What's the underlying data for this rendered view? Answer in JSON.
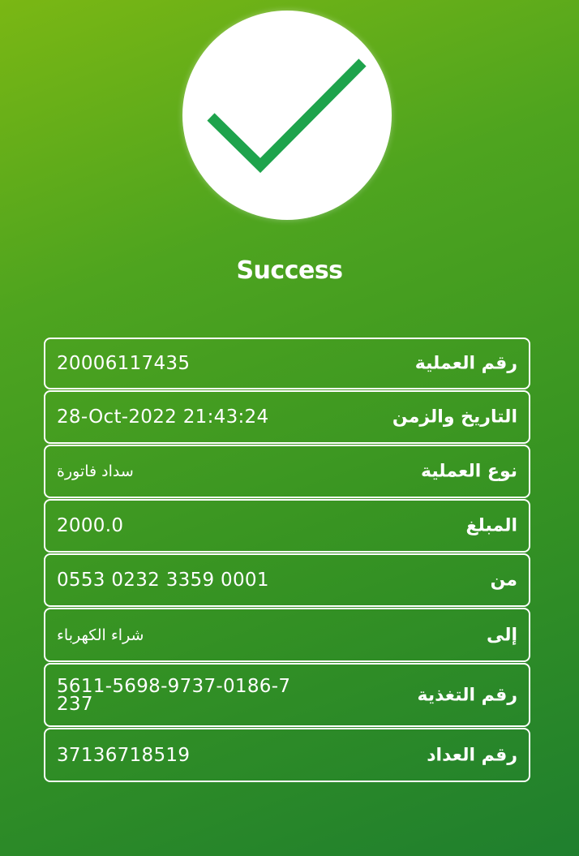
{
  "status": {
    "icon": "checkmark-icon",
    "title": "Success",
    "check_color": "#1ea34c"
  },
  "details": [
    {
      "label": "رقم العملية",
      "value": "20006117435"
    },
    {
      "label": "التاريخ والزمن",
      "value": "28-Oct-2022 21:43:24"
    },
    {
      "label": "نوع العملية",
      "value": "سداد فاتورة"
    },
    {
      "label": "المبلغ",
      "value": "2000.0"
    },
    {
      "label": "من",
      "value": "0553 0232 3359 0001"
    },
    {
      "label": "إلى",
      "value": "شراء الكهرباء"
    },
    {
      "label": "رقم التغذية",
      "value": "5611-5698-9737-0186-7237"
    },
    {
      "label": "رقم العداد",
      "value": "37136718519"
    }
  ]
}
